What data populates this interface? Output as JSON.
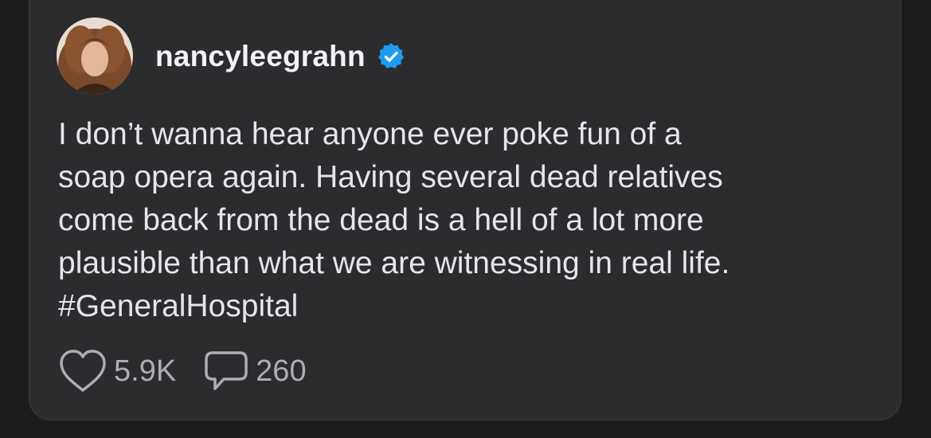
{
  "post": {
    "username": "nancyleegrahn",
    "verified": true,
    "text": "I don’t wanna hear anyone ever poke fun of a\nsoap opera again. Having several dead relatives\ncome back from the dead is a hell of a lot more\nplausible than what we are witnessing in real life.\n#GeneralHospital",
    "likes": "5.9K",
    "comments": "260"
  },
  "icons": {
    "verified": "verified-badge-icon",
    "like": "heart-icon",
    "comment": "speech-bubble-icon"
  },
  "colors": {
    "background": "#1c1c1e",
    "card": "#2c2c2e",
    "text": "#e5e5ea",
    "muted": "#aeaeb2",
    "verified": "#1d9bf0"
  }
}
